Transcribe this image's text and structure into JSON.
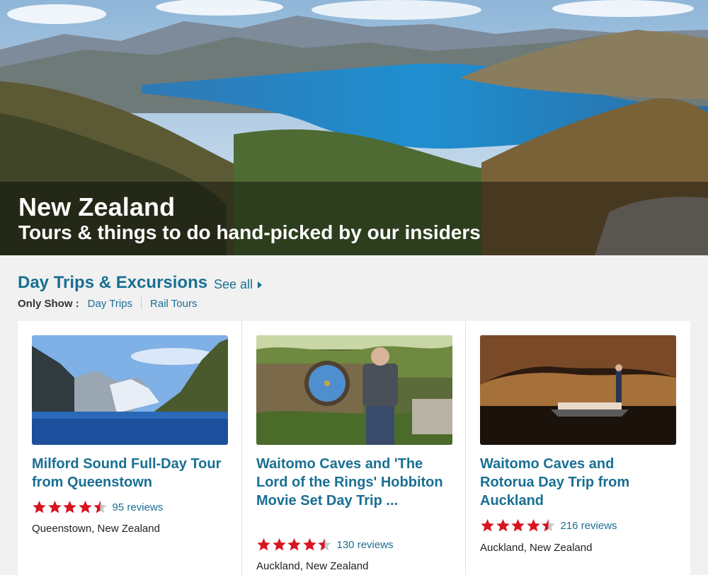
{
  "hero": {
    "title": "New Zealand",
    "subtitle": "Tours & things to do hand-picked by our insiders"
  },
  "section": {
    "title": "Day Trips & Excursions",
    "see_all": "See all",
    "filter_label": "Only Show :",
    "filters": [
      "Day Trips",
      "Rail Tours"
    ]
  },
  "colors": {
    "link": "#1a6f93",
    "star": "#d8141e",
    "star_empty": "#c7c7c7"
  },
  "cards": [
    {
      "title": "Milford Sound Full-Day Tour from Queenstown",
      "rating": 4.5,
      "reviews": "95 reviews",
      "location": "Queenstown, New Zealand"
    },
    {
      "title": "Waitomo Caves and 'The Lord of the Rings' Hobbiton Movie Set Day Trip ...",
      "rating": 4.5,
      "reviews": "130 reviews",
      "location": "Auckland, New Zealand"
    },
    {
      "title": "Waitomo Caves and Rotorua Day Trip from Auckland",
      "rating": 4.5,
      "reviews": "216 reviews",
      "location": "Auckland, New Zealand"
    }
  ]
}
